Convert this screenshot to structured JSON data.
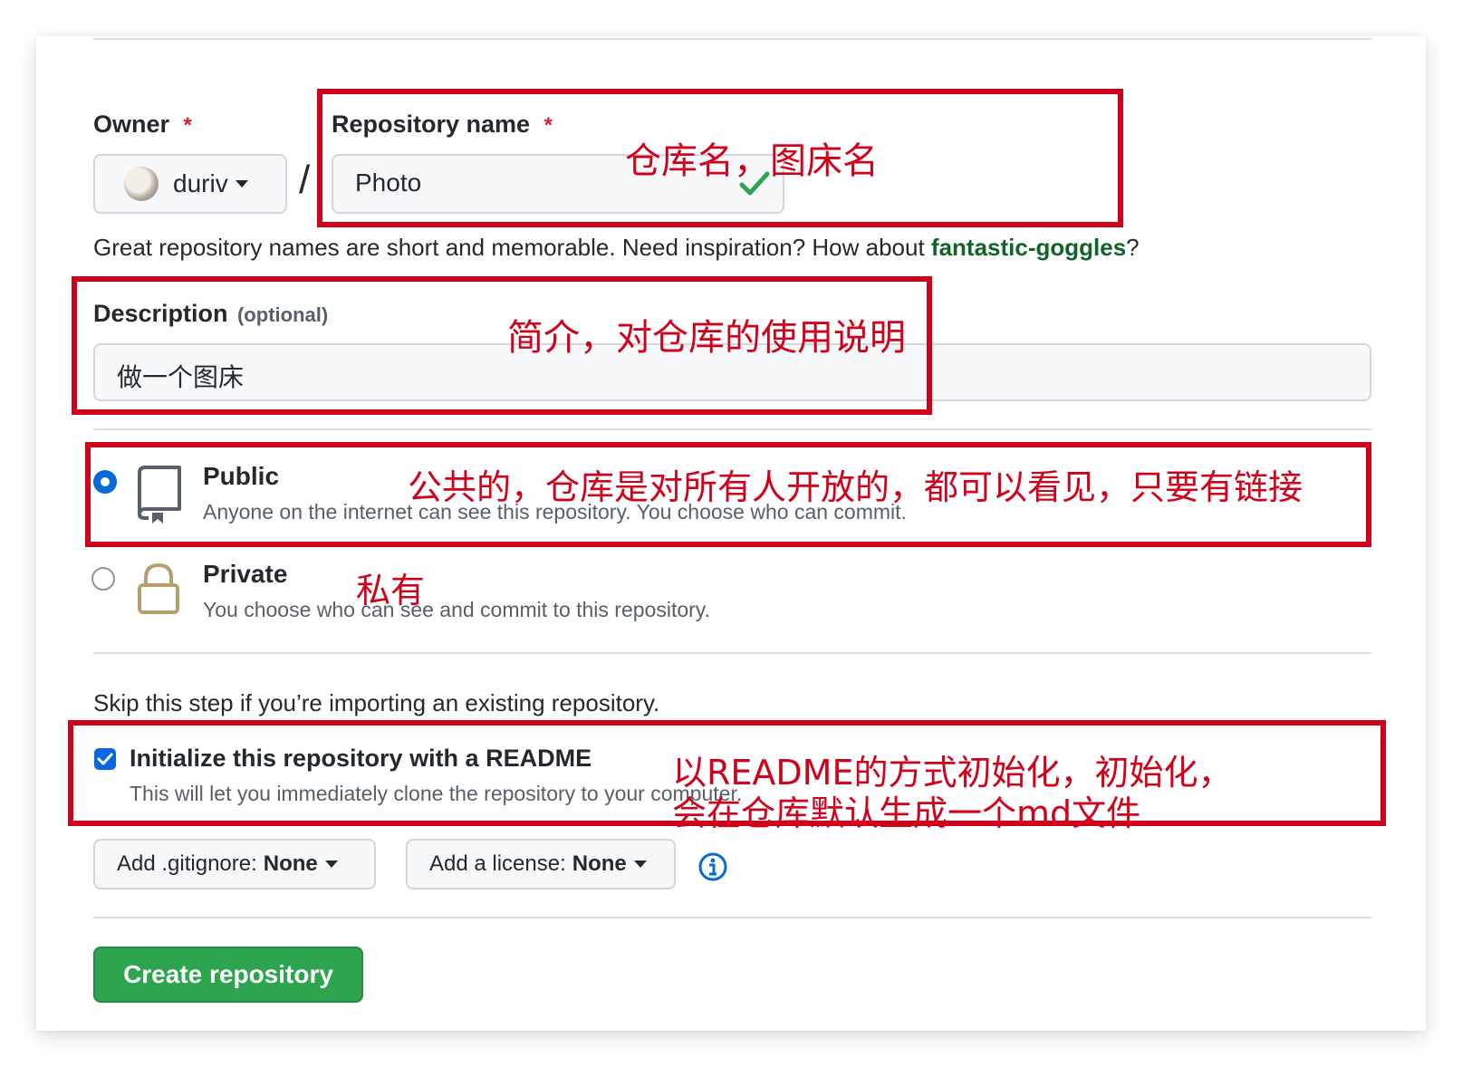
{
  "owner": {
    "label": "Owner",
    "required_mark": "*",
    "value": "duriv"
  },
  "slash": "/",
  "repo_name": {
    "label": "Repository name",
    "required_mark": "*",
    "value": "Photo"
  },
  "name_hint": {
    "prefix": "Great repository names are short and memorable. Need inspiration? How about ",
    "suggestion": "fantastic-goggles",
    "suffix": "?"
  },
  "description": {
    "label": "Description",
    "optional": "(optional)",
    "value": "做一个图床"
  },
  "visibility": {
    "public": {
      "title": "Public",
      "desc": "Anyone on the internet can see this repository. You choose who can commit.",
      "selected": true
    },
    "private": {
      "title": "Private",
      "desc": "You choose who can see and commit to this repository.",
      "selected": false
    }
  },
  "skip_note": "Skip this step if you’re importing an existing repository.",
  "readme": {
    "title": "Initialize this repository with a README",
    "desc": "This will let you immediately clone the repository to your computer.",
    "checked": true
  },
  "gitignore": {
    "prefix": "Add .gitignore:",
    "value": "None"
  },
  "license": {
    "prefix": "Add a license:",
    "value": "None"
  },
  "create_button": "Create repository",
  "annotations": {
    "repo_name": "仓库名，图床名",
    "description": "简介，对仓库的使用说明",
    "public": "公共的，仓库是对所有人开放的，都可以看见，只要有链接",
    "private": "私有",
    "readme_line1": "以README的方式初始化，初始化，",
    "readme_line2": "会在仓库默认生成一个md文件"
  },
  "colors": {
    "annotation_red": "#d0021b",
    "primary_green": "#2da44e",
    "link_green": "#116329",
    "radio_blue": "#0969da",
    "danger_red": "#cf222e"
  },
  "icons": [
    "avatar",
    "check-icon",
    "repo-icon",
    "lock-icon",
    "info-icon",
    "caret-down-icon"
  ]
}
